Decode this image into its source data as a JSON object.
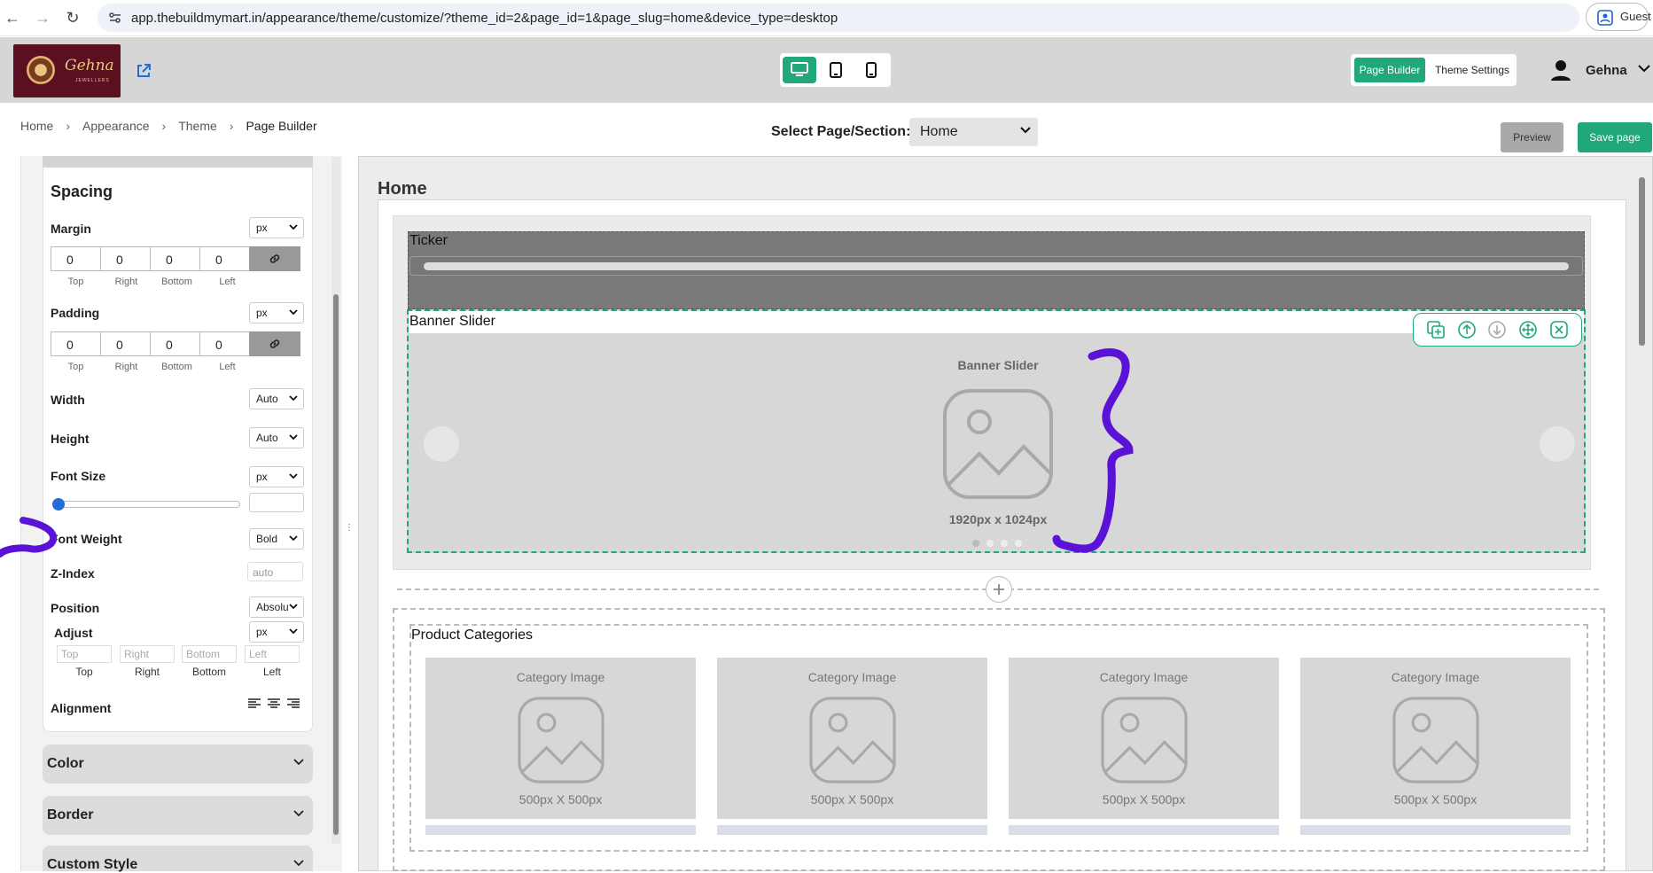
{
  "browser": {
    "url": "app.thebuildmymart.in/appearance/theme/customize/?theme_id=2&page_id=1&page_slug=home&device_type=desktop",
    "profile": "Guest"
  },
  "header": {
    "logo_text": "Gehna",
    "logo_subtext": "JEWELLERS",
    "modes": [
      "Page Builder",
      "Theme Settings"
    ],
    "active_mode": "Page Builder",
    "device_active": "desktop",
    "user_name": "Gehna"
  },
  "breadcrumb": [
    "Home",
    "Appearance",
    "Theme",
    "Page Builder"
  ],
  "page_select": {
    "label": "Select Page/Section:",
    "value": "Home"
  },
  "actions": {
    "preview": "Preview",
    "save": "Save page"
  },
  "panel": {
    "section_title": "Spacing",
    "margin": {
      "label": "Margin",
      "unit": "px",
      "values": [
        "0",
        "0",
        "0",
        "0"
      ],
      "sides": [
        "Top",
        "Right",
        "Bottom",
        "Left"
      ]
    },
    "padding": {
      "label": "Padding",
      "unit": "px",
      "values": [
        "0",
        "0",
        "0",
        "0"
      ],
      "sides": [
        "Top",
        "Right",
        "Bottom",
        "Left"
      ]
    },
    "width": {
      "label": "Width",
      "value": "Auto"
    },
    "height": {
      "label": "Height",
      "value": "Auto"
    },
    "font_size": {
      "label": "Font Size",
      "unit": "px",
      "slider_fraction": 0
    },
    "font_weight": {
      "label": "Font Weight",
      "value": "Bold"
    },
    "z_index": {
      "label": "Z-Index",
      "placeholder": "auto"
    },
    "position": {
      "label": "Position",
      "value": "Absolu"
    },
    "adjust": {
      "label": "Adjust",
      "unit": "px",
      "placeholders": [
        "Top",
        "Right",
        "Bottom",
        "Left"
      ],
      "sides": [
        "Top",
        "Right",
        "Bottom",
        "Left"
      ]
    },
    "alignment": {
      "label": "Alignment"
    },
    "accordions": [
      "Color",
      "Border",
      "Custom Style"
    ]
  },
  "canvas": {
    "title": "Home",
    "ticker_label": "Ticker",
    "banner_label": "Banner Slider",
    "banner_title": "Banner Slider",
    "banner_size": "1920px x 1024px",
    "category_label": "Product Categories",
    "categories": [
      {
        "title": "Category Image",
        "size": "500px X 500px"
      },
      {
        "title": "Category Image",
        "size": "500px X 500px"
      },
      {
        "title": "Category Image",
        "size": "500px X 500px"
      },
      {
        "title": "Category Image",
        "size": "500px X 500px"
      }
    ]
  },
  "colors": {
    "accent": "#20a77a",
    "annotation": "#5a12d6"
  }
}
